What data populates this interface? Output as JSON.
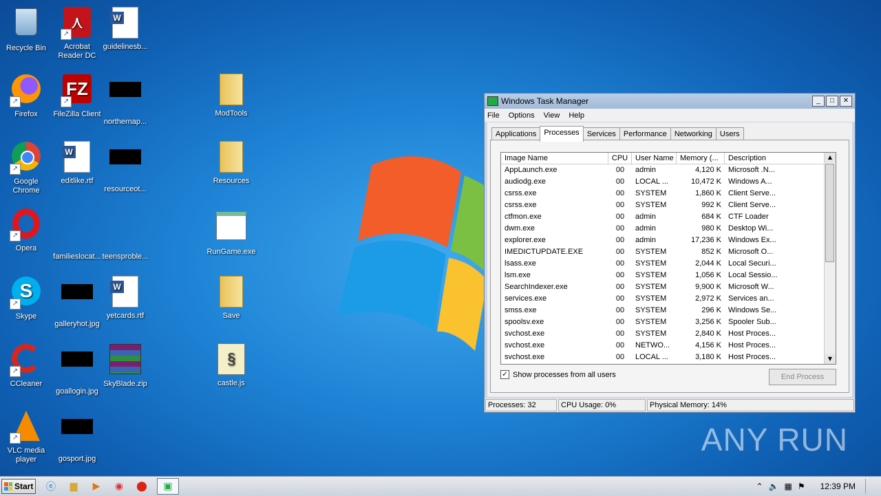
{
  "desktop": {
    "icons": [
      {
        "label": "Recycle Bin",
        "glyph": "recycle-bin-icon"
      },
      {
        "label": "Acrobat Reader DC",
        "glyph": "acrobat-icon"
      },
      {
        "label": "guidelinesb...",
        "glyph": "word-doc-icon"
      },
      {
        "label": "Firefox",
        "glyph": "firefox-icon"
      },
      {
        "label": "FileZilla Client",
        "glyph": "filezilla-icon"
      },
      {
        "label": "northernap...",
        "glyph": "black-thumbnail"
      },
      {
        "label": "ModTools",
        "glyph": "folder-icon"
      },
      {
        "label": "Google Chrome",
        "glyph": "chrome-icon"
      },
      {
        "label": "editlike.rtf",
        "glyph": "word-doc-icon"
      },
      {
        "label": "resourceot...",
        "glyph": "black-thumbnail"
      },
      {
        "label": "Resources",
        "glyph": "folder-icon"
      },
      {
        "label": "Opera",
        "glyph": "opera-icon"
      },
      {
        "label": "familieslocat...",
        "glyph": "blank-thumbnail"
      },
      {
        "label": "teensproble...",
        "glyph": "blank-thumbnail"
      },
      {
        "label": "RunGame.exe",
        "glyph": "exe-window-icon"
      },
      {
        "label": "Skype",
        "glyph": "skype-icon"
      },
      {
        "label": "galleryhot.jpg",
        "glyph": "black-thumbnail"
      },
      {
        "label": "yetcards.rtf",
        "glyph": "word-doc-icon"
      },
      {
        "label": "Save",
        "glyph": "folder-icon"
      },
      {
        "label": "CCleaner",
        "glyph": "ccleaner-icon"
      },
      {
        "label": "goallogin.jpg",
        "glyph": "black-thumbnail"
      },
      {
        "label": "SkyBlade.zip",
        "glyph": "winrar-icon"
      },
      {
        "label": "castle.js",
        "glyph": "script-icon"
      },
      {
        "label": "VLC media player",
        "glyph": "vlc-icon"
      },
      {
        "label": "gosport.jpg",
        "glyph": "black-thumbnail"
      }
    ],
    "watermark": "ANY RUN"
  },
  "taskmanager": {
    "title": "Windows Task Manager",
    "menu": [
      "File",
      "Options",
      "View",
      "Help"
    ],
    "tabs": [
      "Applications",
      "Processes",
      "Services",
      "Performance",
      "Networking",
      "Users"
    ],
    "active_tab": "Processes",
    "columns": [
      "Image Name",
      "CPU",
      "User Name",
      "Memory (...",
      "Description"
    ],
    "rows": [
      [
        "AppLaunch.exe",
        "00",
        "admin",
        "4,120 K",
        "Microsoft .N..."
      ],
      [
        "audiodg.exe",
        "00",
        "LOCAL ...",
        "10,472 K",
        "Windows A..."
      ],
      [
        "csrss.exe",
        "00",
        "SYSTEM",
        "1,860 K",
        "Client Serve..."
      ],
      [
        "csrss.exe",
        "00",
        "SYSTEM",
        "992 K",
        "Client Serve..."
      ],
      [
        "ctfmon.exe",
        "00",
        "admin",
        "684 K",
        "CTF Loader"
      ],
      [
        "dwm.exe",
        "00",
        "admin",
        "980 K",
        "Desktop Wi..."
      ],
      [
        "explorer.exe",
        "00",
        "admin",
        "17,236 K",
        "Windows Ex..."
      ],
      [
        "IMEDICTUPDATE.EXE",
        "00",
        "SYSTEM",
        "852 K",
        "Microsoft O..."
      ],
      [
        "lsass.exe",
        "00",
        "SYSTEM",
        "2,044 K",
        "Local Securi..."
      ],
      [
        "lsm.exe",
        "00",
        "SYSTEM",
        "1,056 K",
        "Local Sessio..."
      ],
      [
        "SearchIndexer.exe",
        "00",
        "SYSTEM",
        "9,900 K",
        "Microsoft W..."
      ],
      [
        "services.exe",
        "00",
        "SYSTEM",
        "2,972 K",
        "Services an..."
      ],
      [
        "smss.exe",
        "00",
        "SYSTEM",
        "296 K",
        "Windows Se..."
      ],
      [
        "spoolsv.exe",
        "00",
        "SYSTEM",
        "3,256 K",
        "Spooler Sub..."
      ],
      [
        "svchost.exe",
        "00",
        "SYSTEM",
        "2,840 K",
        "Host Proces..."
      ],
      [
        "svchost.exe",
        "00",
        "NETWO...",
        "4,156 K",
        "Host Proces..."
      ],
      [
        "svchost.exe",
        "00",
        "LOCAL ...",
        "3,180 K",
        "Host Proces..."
      ]
    ],
    "show_all_label": "Show processes from all users",
    "show_all_checked": true,
    "end_process_label": "End Process",
    "status": {
      "processes": "Processes: 32",
      "cpu": "CPU Usage: 0%",
      "memory": "Physical Memory: 14%"
    }
  },
  "taskbar": {
    "start_label": "Start",
    "pinned": [
      "ie-icon",
      "explorer-icon",
      "media-player-icon",
      "chrome-icon",
      "opera-icon",
      "taskmanager-icon"
    ],
    "clock": "12:39 PM"
  }
}
